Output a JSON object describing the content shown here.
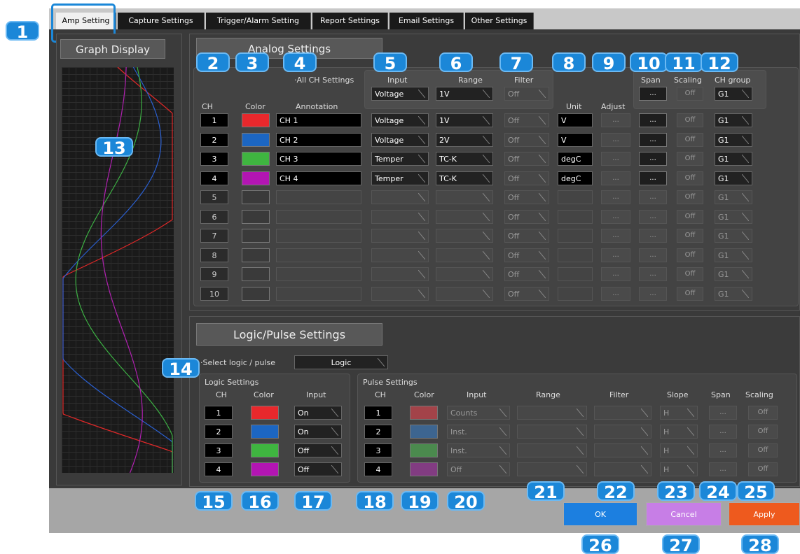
{
  "tabs": [
    "Amp Setting",
    "Capture Settings",
    "Trigger/Alarm Setting",
    "Report Settings",
    "Email Settings",
    "Other Settings"
  ],
  "graph_title": "Graph Display",
  "analog_title": "Analog Settings",
  "logic_title": "Logic/Pulse Settings",
  "labels": {
    "all_ch": "·All CH Settings",
    "input": "Input",
    "range": "Range",
    "filter": "Filter",
    "span": "Span",
    "scaling": "Scaling",
    "ch_group": "CH group",
    "ch": "CH",
    "color": "Color",
    "annotation": "Annotation",
    "unit": "Unit",
    "adjust": "Adjust",
    "select_logic": "·Select logic / pulse",
    "logic_settings": "Logic Settings",
    "pulse_settings": "Pulse Settings",
    "slope": "Slope"
  },
  "all_ch": {
    "input": "Voltage",
    "range": "1V",
    "filter": "Off",
    "span": "...",
    "scaling": "Off",
    "group": "G1"
  },
  "analog_rows": [
    {
      "ch": "1",
      "color": "#e8282c",
      "annotation": "CH 1",
      "input": "Voltage",
      "range": "1V",
      "filter": "Off",
      "unit": "V",
      "adjust": "...",
      "span": "...",
      "scaling": "Off",
      "group": "G1"
    },
    {
      "ch": "2",
      "color": "#1c66c2",
      "annotation": "CH 2",
      "input": "Voltage",
      "range": "2V",
      "filter": "Off",
      "unit": "V",
      "adjust": "...",
      "span": "...",
      "scaling": "Off",
      "group": "G1"
    },
    {
      "ch": "3",
      "color": "#3fb540",
      "annotation": "CH 3",
      "input": "Temper",
      "range": "TC-K",
      "filter": "Off",
      "unit": "degC",
      "adjust": "...",
      "span": "...",
      "scaling": "Off",
      "group": "G1"
    },
    {
      "ch": "4",
      "color": "#b315b3",
      "annotation": "CH 4",
      "input": "Temper",
      "range": "TC-K",
      "filter": "Off",
      "unit": "degC",
      "adjust": "...",
      "span": "...",
      "scaling": "Off",
      "group": "G1"
    },
    {
      "ch": "5",
      "color": "",
      "annotation": "",
      "input": "",
      "range": "",
      "filter": "Off",
      "unit": "",
      "adjust": "...",
      "span": "...",
      "scaling": "Off",
      "group": "G1"
    },
    {
      "ch": "6",
      "color": "",
      "annotation": "",
      "input": "",
      "range": "",
      "filter": "Off",
      "unit": "",
      "adjust": "...",
      "span": "...",
      "scaling": "Off",
      "group": "G1"
    },
    {
      "ch": "7",
      "color": "",
      "annotation": "",
      "input": "",
      "range": "",
      "filter": "Off",
      "unit": "",
      "adjust": "...",
      "span": "...",
      "scaling": "Off",
      "group": "G1"
    },
    {
      "ch": "8",
      "color": "",
      "annotation": "",
      "input": "",
      "range": "",
      "filter": "Off",
      "unit": "",
      "adjust": "...",
      "span": "...",
      "scaling": "Off",
      "group": "G1"
    },
    {
      "ch": "9",
      "color": "",
      "annotation": "",
      "input": "",
      "range": "",
      "filter": "Off",
      "unit": "",
      "adjust": "...",
      "span": "...",
      "scaling": "Off",
      "group": "G1"
    },
    {
      "ch": "10",
      "color": "",
      "annotation": "",
      "input": "",
      "range": "",
      "filter": "Off",
      "unit": "",
      "adjust": "...",
      "span": "...",
      "scaling": "Off",
      "group": "G1"
    }
  ],
  "logic_select": "Logic",
  "logic_rows": [
    {
      "ch": "1",
      "color": "#e8282c",
      "input": "On"
    },
    {
      "ch": "2",
      "color": "#1c66c2",
      "input": "On"
    },
    {
      "ch": "3",
      "color": "#3fb540",
      "input": "Off"
    },
    {
      "ch": "4",
      "color": "#b315b3",
      "input": "Off"
    }
  ],
  "pulse_rows": [
    {
      "ch": "1",
      "color": "#a34349",
      "input": "Counts",
      "slope": "H",
      "span": "...",
      "scaling": "Off"
    },
    {
      "ch": "2",
      "color": "#3d6590",
      "input": "Inst.",
      "slope": "H",
      "span": "...",
      "scaling": "Off"
    },
    {
      "ch": "3",
      "color": "#4b8a4e",
      "input": "Inst.",
      "slope": "H",
      "span": "...",
      "scaling": "Off"
    },
    {
      "ch": "4",
      "color": "#823c82",
      "input": "Off",
      "slope": "H",
      "span": "...",
      "scaling": "Off"
    }
  ],
  "buttons": {
    "ok": "OK",
    "cancel": "Cancel",
    "apply": "Apply"
  },
  "badges": [
    "1",
    "2",
    "3",
    "4",
    "5",
    "6",
    "7",
    "8",
    "9",
    "10",
    "11",
    "12",
    "13",
    "14",
    "15",
    "16",
    "17",
    "18",
    "19",
    "20",
    "21",
    "22",
    "23",
    "24",
    "25",
    "26",
    "27",
    "28"
  ]
}
